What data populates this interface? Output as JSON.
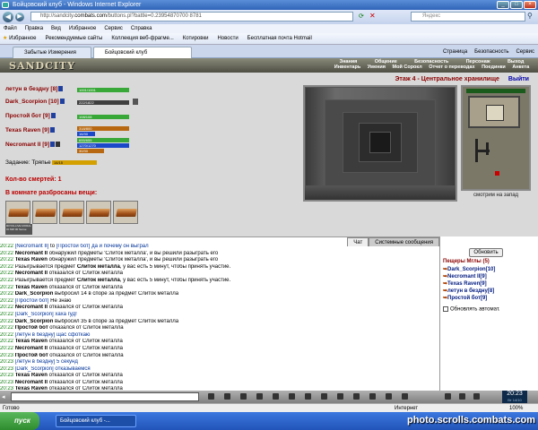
{
  "window": {
    "title": "Бойцовский клуб - Windows Internet Explorer"
  },
  "address": {
    "url_gray": "http://sandcity.",
    "url_bold": "combats.com",
    "url_rest": "/buttons.pl?battle=0.23954870700 8781",
    "search_placeholder": "Яндекс"
  },
  "menubar": {
    "items": [
      "Файл",
      "Правка",
      "Вид",
      "Избранное",
      "Сервис",
      "Справка"
    ]
  },
  "favorites": {
    "label": "Избранное",
    "items": [
      "Рекомендуемые сайты",
      "Коллекция веб-фрагме...",
      "Котировки",
      "Новости",
      "Бесплатная почта Hotmail"
    ]
  },
  "tabs": [
    {
      "label": "Забытые Измерения"
    },
    {
      "label": "Бойцовский клуб"
    }
  ],
  "commands": {
    "items": [
      "Страница",
      "Безопасность",
      "Сервис"
    ]
  },
  "game": {
    "logo": "SANDCITY",
    "nav_row1": [
      "Знания",
      "Общение",
      "Безопасность",
      "Персонаж",
      "Выход"
    ],
    "nav_row2": [
      "Инвентарь",
      "Умения",
      "Мой Сорокл",
      "Отчет о переводах",
      "Поединки",
      "Анкета"
    ],
    "players": [
      {
        "name": "летун в бездну",
        "level": "[8]",
        "hp": "1001/1001"
      },
      {
        "name": "Dark_Scorpion",
        "level": "[10]",
        "hp": "222/1822"
      },
      {
        "name": "Простой бот",
        "level": "[9]",
        "hp": "108/108"
      },
      {
        "name": "Texas Raven",
        "level": "[9]",
        "hp1": "318/800",
        "hp2": "16/30"
      },
      {
        "name": "Necromant II",
        "level": "[9]",
        "hp1": "655/655",
        "hp2": "1270/1270",
        "hp3": "30/30"
      }
    ],
    "task_label": "Задание: Тряпье",
    "task_value": "14/15",
    "deaths": "Кол-во смертей: 1",
    "scattered": "В комнате разбросаны вещи:",
    "small_sign": "ROYALLIVE MORAL Ot MM 00 Sense",
    "floor": "Этаж 4 - Центральное хранилище",
    "exit": "Выйти",
    "look": "смотрим на запад"
  },
  "chat": {
    "tabs": [
      "Чат",
      "Системные сообщения"
    ],
    "lines": [
      {
        "time": "20:22",
        "parts": [
          [
            "pv",
            "[Necromant II]"
          ],
          [
            "txt",
            " to "
          ],
          [
            "pv",
            "[Простой бот]"
          ],
          [
            "pv",
            " да и почему он выграл"
          ]
        ]
      },
      {
        "time": "20:22",
        "parts": [
          [
            "n",
            "Necromant II"
          ],
          [
            "txt",
            " обнаружил предметы 'Слиток металла', и вы решили разыграть его"
          ]
        ]
      },
      {
        "time": "20:22",
        "parts": [
          [
            "n",
            "Texas Raven"
          ],
          [
            "txt",
            " обнаружил предметы 'Слиток металла', и вы решили разыграть его"
          ]
        ]
      },
      {
        "time": "20:22",
        "parts": [
          [
            "txt",
            "Разыгрывается предмет "
          ],
          [
            "it",
            "Слиток металла"
          ],
          [
            "txt",
            ", у вас есть 5 минут, чтобы принять участие."
          ]
        ]
      },
      {
        "time": "20:22",
        "parts": [
          [
            "n",
            "Necromant II"
          ],
          [
            "txt",
            " отказался от Слиток металла"
          ]
        ]
      },
      {
        "time": "20:22",
        "parts": [
          [
            "txt",
            "Разыгрывается предмет "
          ],
          [
            "it",
            "Слиток металла"
          ],
          [
            "txt",
            ", у вас есть 5 минут, чтобы принять участие."
          ]
        ]
      },
      {
        "time": "20:22",
        "parts": [
          [
            "n",
            "Texas Raven"
          ],
          [
            "txt",
            " отказался от Слиток металла"
          ]
        ]
      },
      {
        "time": "20:22",
        "parts": [
          [
            "n",
            "Dark_Scorpion"
          ],
          [
            "txt",
            " выбросил 14 в споре за предмет Слиток металла"
          ]
        ]
      },
      {
        "time": "20:22",
        "parts": [
          [
            "pv",
            "[Простой бот]"
          ],
          [
            "txt",
            " Не знаю"
          ]
        ]
      },
      {
        "time": "20:22",
        "parts": [
          [
            "n",
            "Necromant II"
          ],
          [
            "txt",
            " отказался от Слиток металла"
          ]
        ]
      },
      {
        "time": "20:22",
        "parts": [
          [
            "pv",
            "[Dark_Scorpion]"
          ],
          [
            "pv",
            " хаха гуд!"
          ]
        ]
      },
      {
        "time": "20:22",
        "parts": [
          [
            "n",
            "Dark_Scorpion"
          ],
          [
            "txt",
            " выбросил 35 в споре за предмет Слиток металла"
          ]
        ]
      },
      {
        "time": "20:22",
        "parts": [
          [
            "n",
            "Простой бот"
          ],
          [
            "txt",
            " отказался от Слиток металла"
          ]
        ]
      },
      {
        "time": "20:22",
        "parts": [
          [
            "pv",
            "[летун в бездну]"
          ],
          [
            "pv",
            " щас сфоткаю"
          ]
        ]
      },
      {
        "time": "20:22",
        "parts": [
          [
            "n",
            "Texas Raven"
          ],
          [
            "txt",
            " отказался от Слиток металла"
          ]
        ]
      },
      {
        "time": "20:22",
        "parts": [
          [
            "n",
            "Necromant II"
          ],
          [
            "txt",
            " отказался от Слиток металла"
          ]
        ]
      },
      {
        "time": "20:23",
        "parts": [
          [
            "n",
            "Простой бот"
          ],
          [
            "txt",
            " отказался от Слиток металла"
          ]
        ]
      },
      {
        "time": "20:23",
        "parts": [
          [
            "pv",
            "[летун в бездну]"
          ],
          [
            "pv",
            " 5 секунд"
          ]
        ]
      },
      {
        "time": "20:23",
        "parts": [
          [
            "pv",
            "[Dark_Scorpion]"
          ],
          [
            "pv",
            " отказываемся"
          ]
        ]
      },
      {
        "time": "20:23",
        "parts": [
          [
            "n",
            "Texas Raven"
          ],
          [
            "txt",
            " отказался от Слиток металла"
          ]
        ]
      },
      {
        "time": "20:23",
        "parts": [
          [
            "n",
            "Necromant II"
          ],
          [
            "txt",
            " отказался от Слиток металла"
          ]
        ]
      },
      {
        "time": "20:23",
        "parts": [
          [
            "n",
            "Texas Raven"
          ],
          [
            "txt",
            " отказался от Слиток металла"
          ]
        ]
      }
    ]
  },
  "online": {
    "refresh": "Обновить",
    "header": "Пещеры Мглы (5)",
    "users": [
      "Dark_Scorpion[10]",
      "Necromant II[9]",
      "Texas Raven[9]",
      "летун в бездну[8]",
      "Простой бот[9]"
    ],
    "auto": "Обновлять автомат."
  },
  "clock": {
    "time": "20:23",
    "small": "Вт 14/10"
  },
  "status": {
    "left": "Готово",
    "zone": "Интернет",
    "zoom": "100%"
  },
  "taskbar": {
    "start": "пуск",
    "window": "Бойцовский клуб -...",
    "watermark": "photo.scrolls.combats.com"
  }
}
